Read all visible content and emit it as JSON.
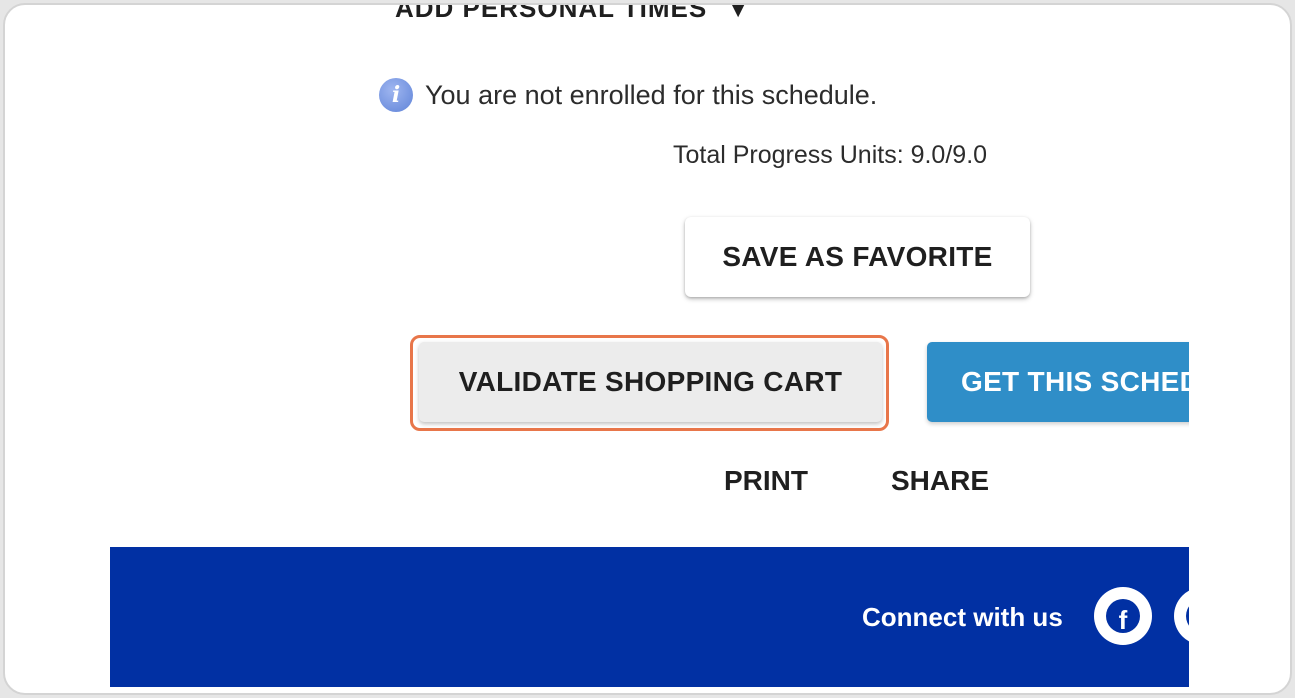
{
  "schedule": {
    "add_personal_times_label": "ADD PERSONAL TIMES",
    "enrollment_notice": "You are not enrolled for this schedule.",
    "progress_units": "Total Progress Units: 9.0/9.0"
  },
  "actions": {
    "save_favorite_label": "SAVE AS FAVORITE",
    "validate_cart_label": "VALIDATE SHOPPING CART",
    "get_schedule_label": "GET THIS SCHEDULE",
    "print_label": "PRINT",
    "share_label": "SHARE"
  },
  "footer": {
    "connect_label": "Connect with us",
    "social_icons": [
      "facebook-icon",
      "social-icon"
    ]
  },
  "colors": {
    "footer_bg": "#0130a3",
    "primary_button": "#2f8ec8",
    "highlight_outline": "#e8764a",
    "info_icon": "#5f83d8"
  }
}
